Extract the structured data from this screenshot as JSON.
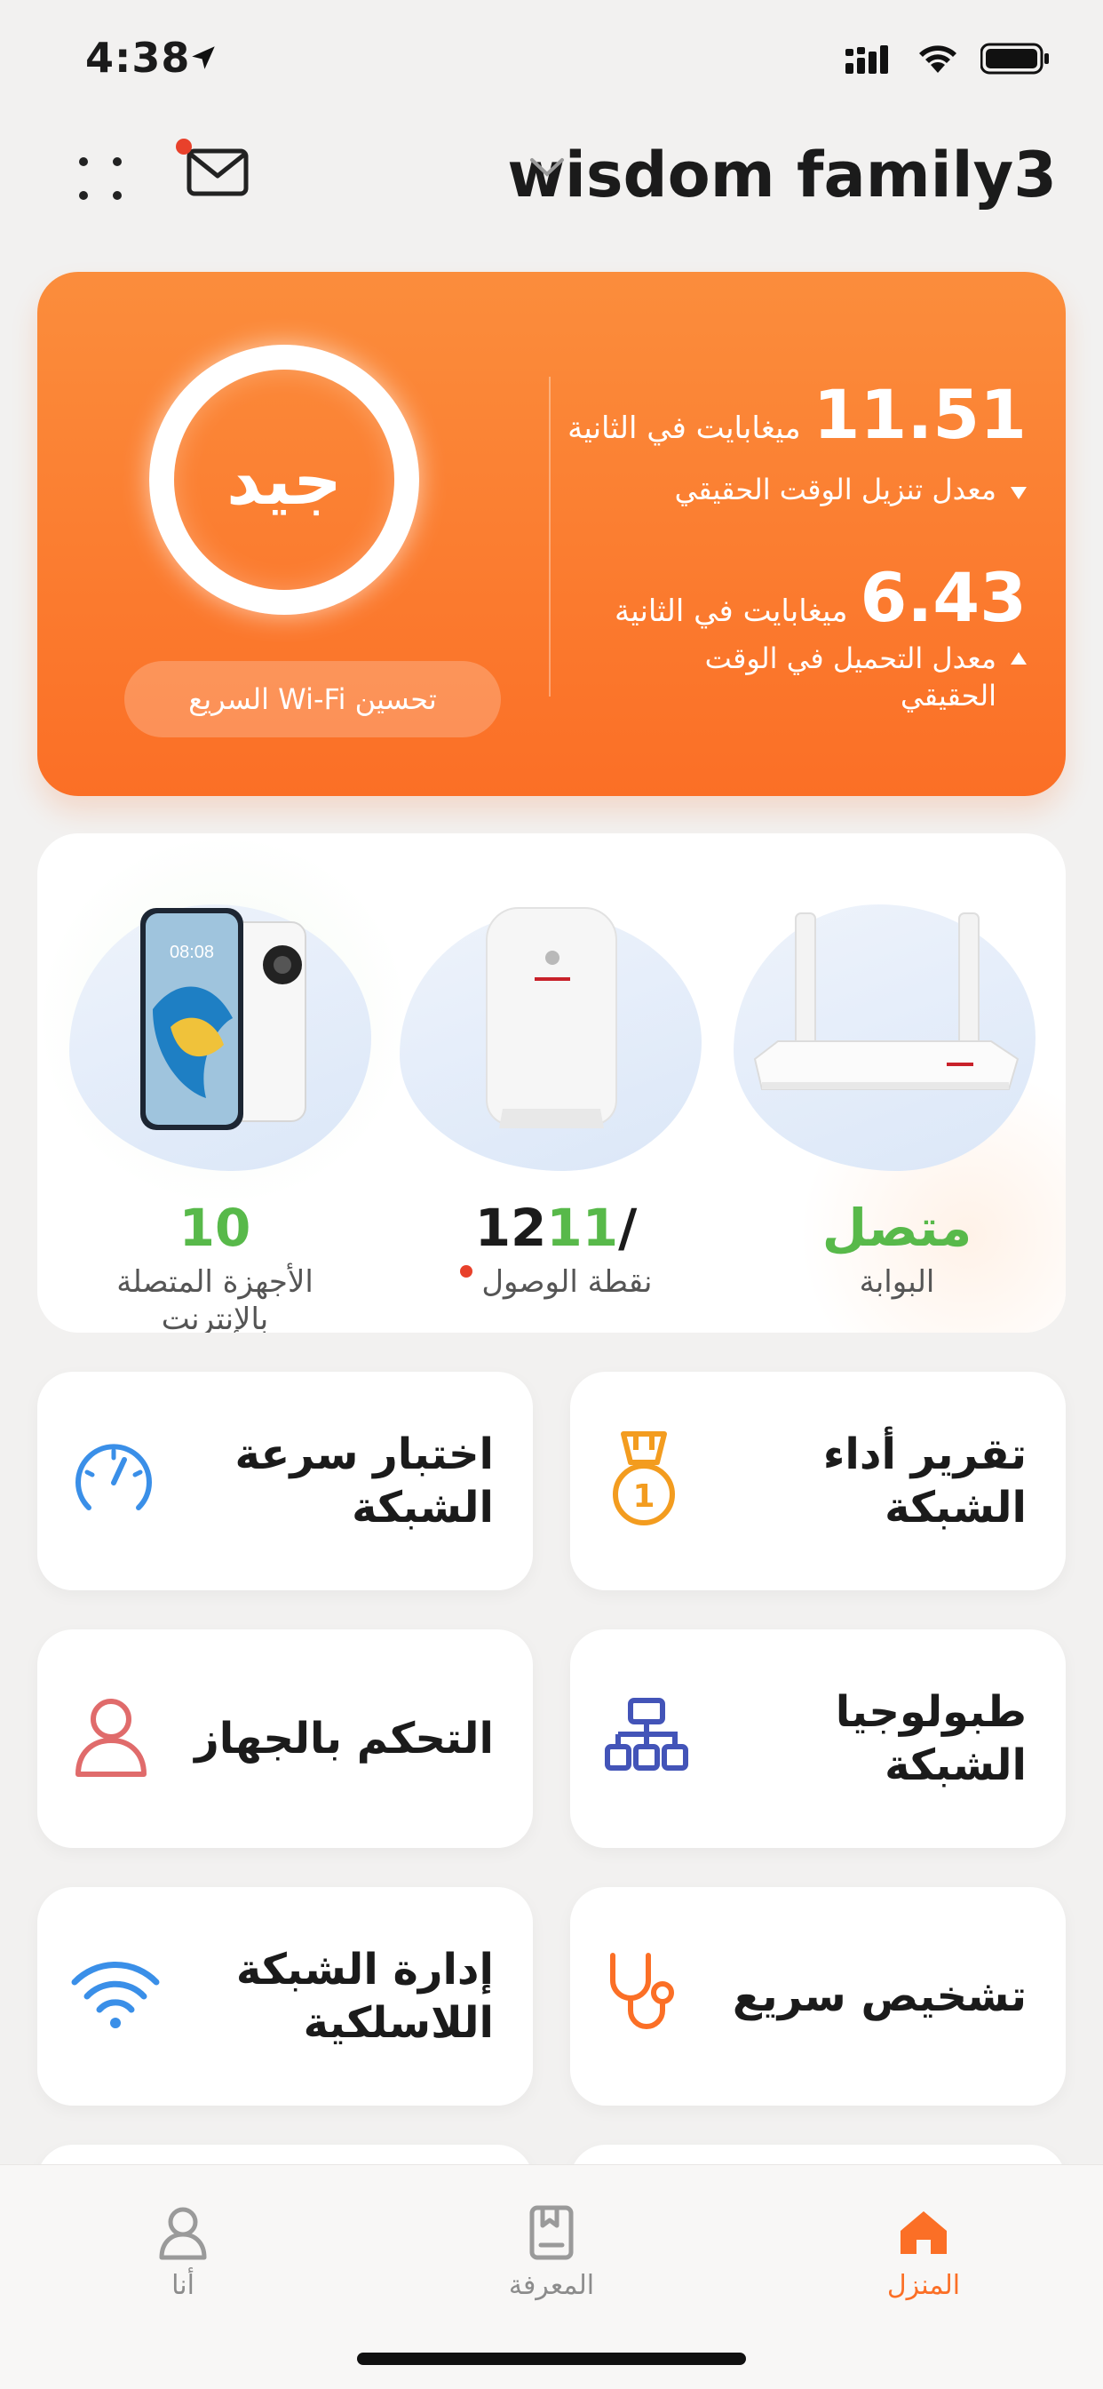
{
  "status_bar": {
    "time": "4:38"
  },
  "header": {
    "family_name": "wisdom family3"
  },
  "speed_card": {
    "quality": "جيد",
    "optimize_button": "تحسين Wi-Fi السريع",
    "download": {
      "value": "11.51",
      "unit": "ميغابايت في الثانية",
      "label": "معدل تنزيل الوقت الحقيقي"
    },
    "upload": {
      "value": "6.43",
      "unit": "ميغابايت في الثانية",
      "label_line1": "معدل التحميل في الوقت",
      "label_line2": "الحقيقي"
    }
  },
  "devices": {
    "gateway": {
      "value": "متصل",
      "label": "البوابة"
    },
    "access_point": {
      "value_online": "11",
      "value_total": "/12",
      "label": "نقطة الوصول"
    },
    "connected": {
      "value": "10",
      "label_line1": "الأجهزة المتصلة",
      "label_line2": "بالإنترنت"
    }
  },
  "tiles": [
    {
      "label": "تقرير أداء الشبكة",
      "icon": "medal-icon",
      "color": "#f39c1f"
    },
    {
      "label": "اختبار سرعة الشبكة",
      "icon": "speedometer-icon",
      "color": "#3a8fe8"
    },
    {
      "label": "طبولوجيا الشبكة",
      "icon": "topology-icon",
      "color": "#4354b8"
    },
    {
      "label": "التحكم بالجهاز",
      "icon": "person-icon",
      "color": "#e06b6b"
    },
    {
      "label": "تشخيص سريع",
      "icon": "stethoscope-icon",
      "color": "#fb6f26"
    },
    {
      "label": "إدارة الشبكة اللاسلكية",
      "icon": "wifi-icon",
      "color": "#3a8fe8"
    }
  ],
  "bottom_nav": {
    "home": "المنزل",
    "knowledge": "المعرفة",
    "me": "أنا"
  },
  "colors": {
    "accent": "#fb6f26",
    "green": "#58b94a",
    "notification": "#e8412b"
  }
}
